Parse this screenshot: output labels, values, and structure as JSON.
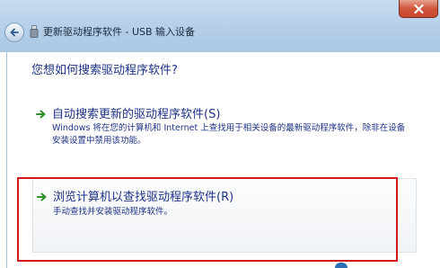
{
  "window": {
    "title": "更新驱动程序软件 - USB 输入设备"
  },
  "main": {
    "heading": "您想如何搜索驱动程序软件?",
    "options": [
      {
        "title": "自动搜索更新的驱动程序软件(S)",
        "description": "Windows 将在您的计算机和 Internet 上查找用于相关设备的最新驱动程序软件，除非在设备安装设置中禁用该功能。"
      },
      {
        "title": "浏览计算机以查找驱动程序软件(R)",
        "description": "手动查找并安装驱动程序软件。"
      }
    ]
  },
  "colors": {
    "link_text": "#1e3287",
    "arrow_green": "#2f8f2a",
    "highlight_red": "#d0171d",
    "titlebar": "#b8d1ea"
  },
  "icons": {
    "back": "back-arrow-icon",
    "device": "usb-device-icon",
    "close": "close-icon",
    "option_arrow": "green-arrow-icon"
  }
}
